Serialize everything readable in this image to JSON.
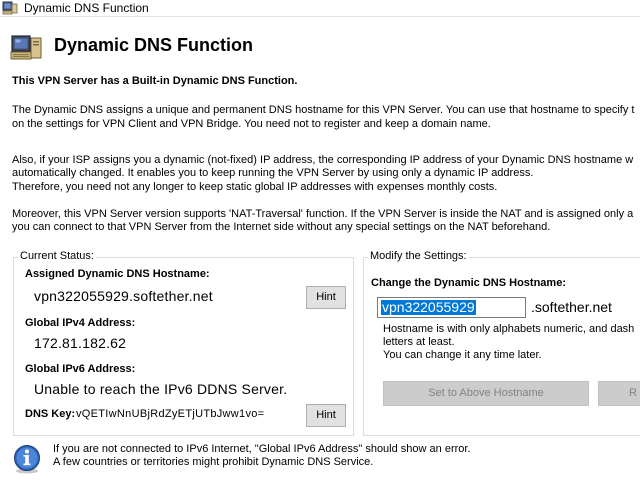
{
  "window": {
    "title": "Dynamic DNS Function"
  },
  "header": {
    "title": "Dynamic DNS Function"
  },
  "intro": {
    "heading": "This VPN Server has a Built-in Dynamic DNS Function.",
    "para1_line1": "The Dynamic DNS assigns a unique and permanent DNS hostname for this VPN Server. You can use that hostname to specify t",
    "para1_line2": "on the settings for VPN Client and VPN Bridge. You need not to register and keep a domain name.",
    "para2_line1": "Also, if your ISP assigns you a dynamic (not-fixed) IP address, the corresponding IP address of your Dynamic DNS hostname w",
    "para2_line2": "automatically changed. It enables you to keep running the VPN Server by using only a dynamic IP address.",
    "para2_line3": "Therefore, you need not any longer to keep static global IP addresses with expenses monthly costs.",
    "para3_line1": "Moreover, this VPN Server version supports 'NAT-Traversal' function. If the VPN Server is inside the NAT and is assigned only a",
    "para3_line2": "you can connect to that VPN Server from the Internet side without any special settings on the NAT beforehand."
  },
  "current_status": {
    "group_label": "Current Status:",
    "hostname_label": "Assigned Dynamic DNS Hostname:",
    "hostname_value": "vpn322055929.softether.net",
    "hint_label": "Hint",
    "ipv4_label": "Global IPv4 Address:",
    "ipv4_value": "172.81.182.62",
    "ipv6_label": "Global IPv6 Address:",
    "ipv6_value": "Unable to reach the IPv6 DDNS Server.",
    "dnskey_label": "DNS Key:",
    "dnskey_value": "vQETIwNnUBjRdZyETjUTbJww1vo=",
    "hint2_label": "Hint"
  },
  "modify": {
    "group_label": "Modify the Settings:",
    "change_label": "Change the Dynamic DNS Hostname:",
    "hostname_input_value": "vpn322055929",
    "suffix": ".softether.net",
    "note_line1": "Hostname is with only alphabets numeric, and dash",
    "note_line2": "letters at least.",
    "note_line3": "You can change it any time later.",
    "set_button_label": "Set to Above Hostname",
    "restore_button_label": "R"
  },
  "footer": {
    "line1": "If you are not connected to IPv6 Internet, \"Global IPv6 Address\" should show an error.",
    "line2": "A few countries or territories might prohibit Dynamic DNS Service."
  },
  "icons": {
    "window": "computer-icon",
    "header": "computer-icon",
    "footer": "info-icon"
  }
}
